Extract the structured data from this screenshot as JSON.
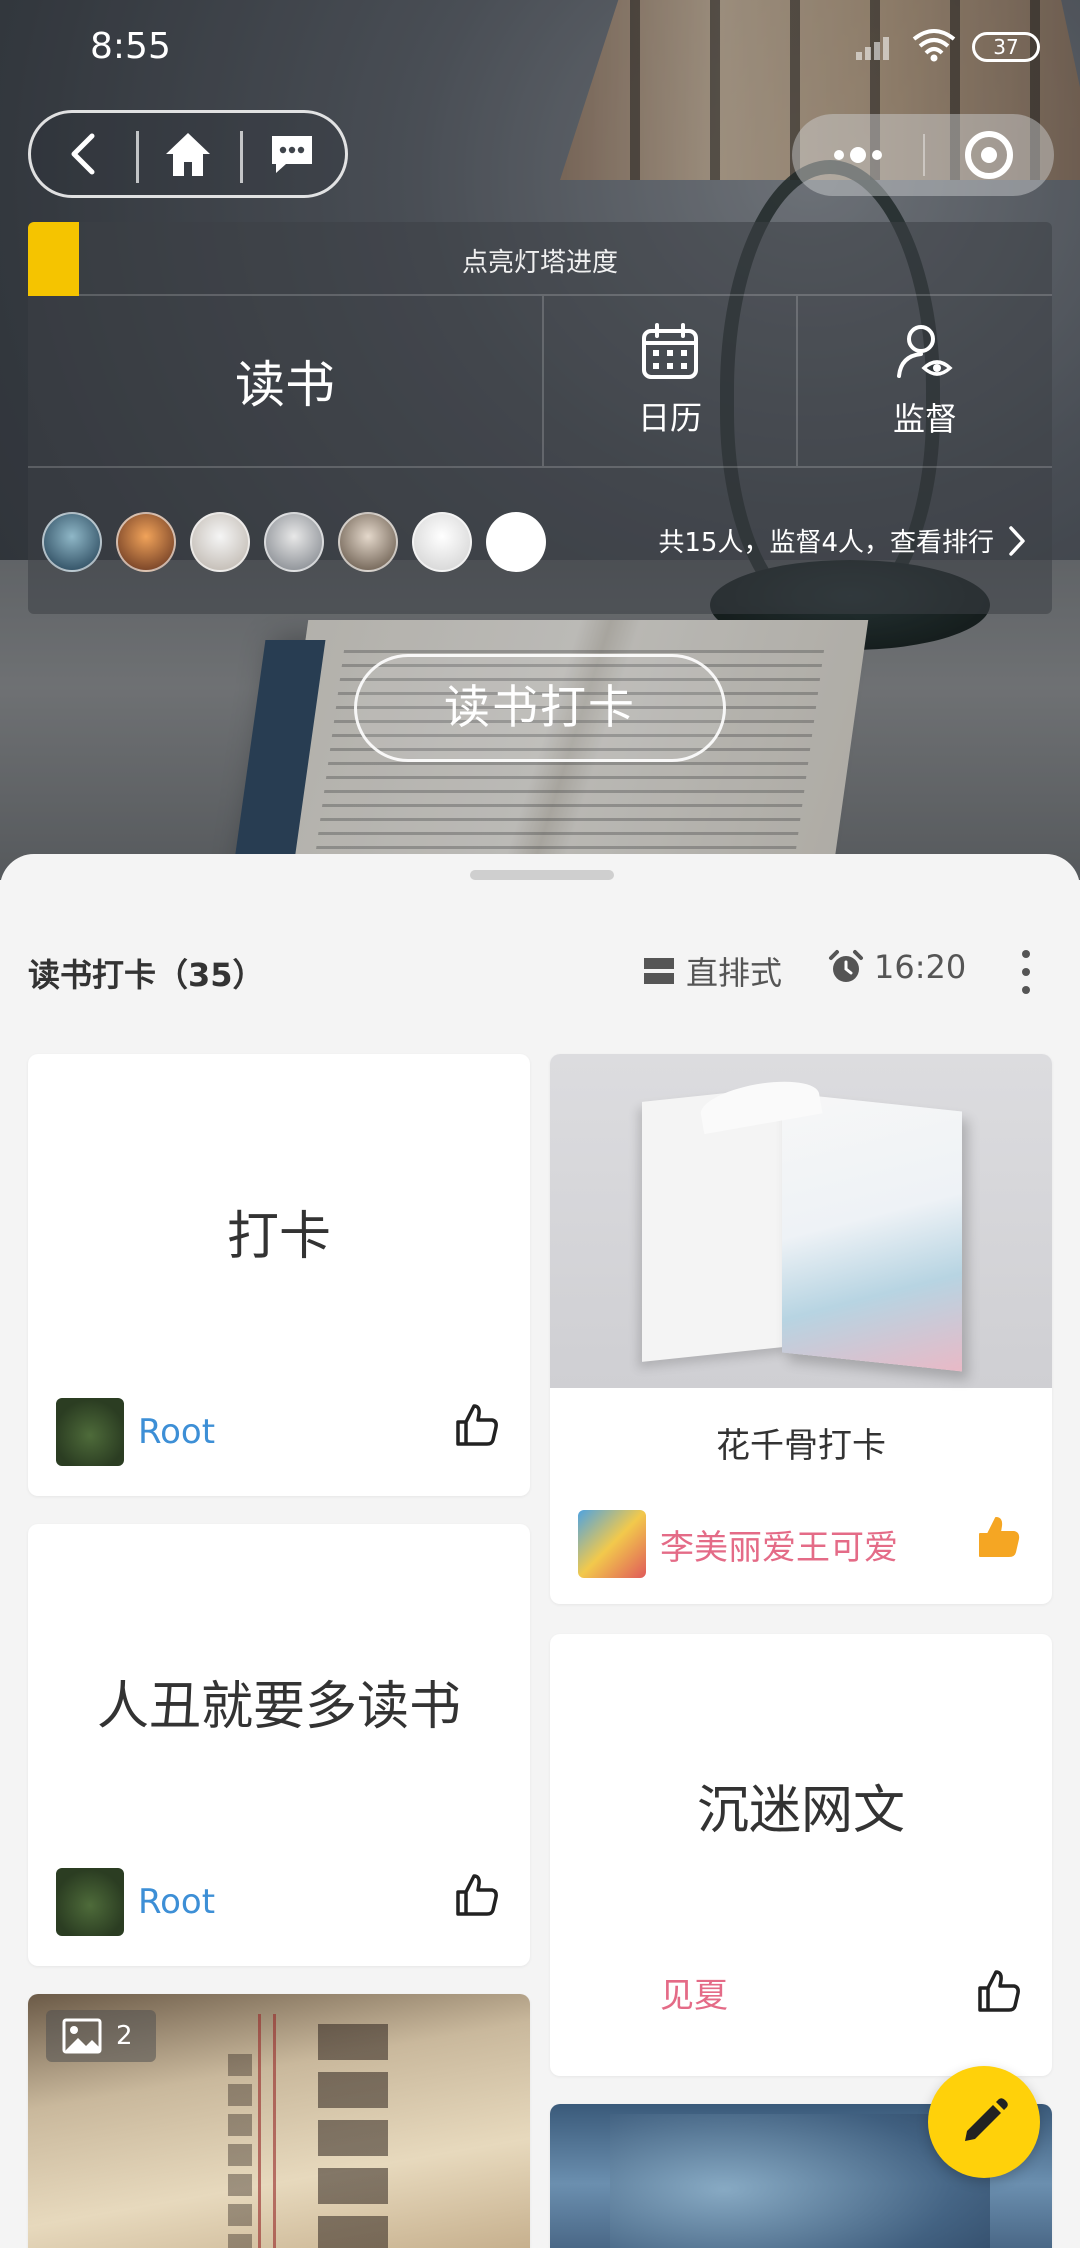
{
  "status_bar": {
    "time": "8:55",
    "battery": "37"
  },
  "panel": {
    "progress_label": "点亮灯塔进度",
    "progress_fraction": 0.05,
    "title": "读书",
    "calendar_label": "日历",
    "supervise_label": "监督",
    "ranking_text": "共15人，监督4人，查看排行"
  },
  "checkin_button": "读书打卡",
  "feed": {
    "title": "读书打卡（35）",
    "layout_label": "直排式",
    "alarm_time": "16:20"
  },
  "cards": [
    {
      "text": "打卡",
      "user": "Root"
    },
    {
      "text": "花千骨打卡",
      "user": "李美丽爱王可爱",
      "image_count": ""
    },
    {
      "text": "人丑就要多读书",
      "user": "Root"
    },
    {
      "text": "沉迷网文",
      "user": "见夏"
    },
    {
      "image_count": "2"
    }
  ],
  "colors": {
    "accent": "#ffd10a",
    "progress": "#f5c400",
    "link_blue": "#3d8fd6",
    "link_pink": "#e46b87",
    "like_orange": "#f5a623"
  },
  "icons": [
    "back-icon",
    "home-icon",
    "message-icon",
    "more-dots-icon",
    "target-icon",
    "calendar-icon",
    "supervise-icon",
    "chevron-right-icon",
    "layout-icon",
    "alarm-icon",
    "more-vertical-icon",
    "thumb-up-icon",
    "image-icon",
    "pencil-icon"
  ]
}
